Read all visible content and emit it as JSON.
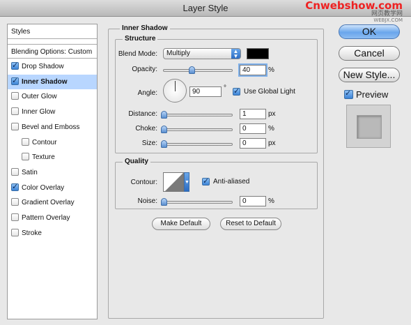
{
  "window": {
    "title": "Layer Style"
  },
  "watermark": {
    "line1": "Cnwebshow.com",
    "line2": "网页教学网",
    "line3": "WEBJX.COM"
  },
  "sidebar": {
    "header": "Styles",
    "blending": "Blending Options: Custom",
    "items": [
      {
        "label": "Drop Shadow",
        "checked": true
      },
      {
        "label": "Inner Shadow",
        "checked": true,
        "selected": true
      },
      {
        "label": "Outer Glow",
        "checked": false
      },
      {
        "label": "Inner Glow",
        "checked": false
      },
      {
        "label": "Bevel and Emboss",
        "checked": false
      },
      {
        "label": "Contour",
        "checked": false,
        "indent": true
      },
      {
        "label": "Texture",
        "checked": false,
        "indent": true
      },
      {
        "label": "Satin",
        "checked": false
      },
      {
        "label": "Color Overlay",
        "checked": true
      },
      {
        "label": "Gradient Overlay",
        "checked": false
      },
      {
        "label": "Pattern Overlay",
        "checked": false
      },
      {
        "label": "Stroke",
        "checked": false
      }
    ]
  },
  "panel": {
    "title": "Inner Shadow",
    "structure": {
      "legend": "Structure",
      "blend_mode_label": "Blend Mode:",
      "blend_mode_value": "Multiply",
      "shadow_color": "#000000",
      "opacity_label": "Opacity:",
      "opacity_value": "40",
      "opacity_unit": "%",
      "opacity_slider": 0.4,
      "angle_label": "Angle:",
      "angle_value": "90",
      "angle_unit": "°",
      "use_global_light_label": "Use Global Light",
      "use_global_light_checked": true,
      "distance_label": "Distance:",
      "distance_value": "1",
      "distance_unit": "px",
      "choke_label": "Choke:",
      "choke_value": "0",
      "choke_unit": "%",
      "size_label": "Size:",
      "size_value": "0",
      "size_unit": "px"
    },
    "quality": {
      "legend": "Quality",
      "contour_label": "Contour:",
      "anti_aliased_label": "Anti-aliased",
      "anti_aliased_checked": true,
      "noise_label": "Noise:",
      "noise_value": "0",
      "noise_unit": "%"
    },
    "make_default": "Make Default",
    "reset_default": "Reset to Default"
  },
  "actions": {
    "ok": "OK",
    "cancel": "Cancel",
    "new_style": "New Style...",
    "preview_label": "Preview",
    "preview_checked": true
  }
}
